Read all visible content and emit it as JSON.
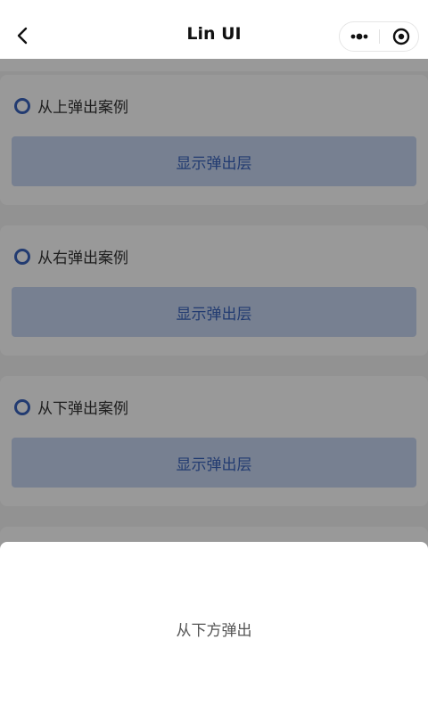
{
  "header": {
    "title": "Lin UI",
    "back_icon": "chevron-left-icon",
    "more_icon": "more-dots-icon",
    "close_icon": "record-icon"
  },
  "sections": [
    {
      "title": "从上弹出案例",
      "button_label": "显示弹出层"
    },
    {
      "title": "从右弹出案例",
      "button_label": "显示弹出层"
    },
    {
      "title": "从下弹出案例",
      "button_label": "显示弹出层"
    }
  ],
  "popup": {
    "text": "从下方弹出"
  },
  "colors": {
    "accent": "#3963bc",
    "button_bg": "#c6d6f2",
    "overlay": "rgba(0,0,0,0.40)"
  }
}
